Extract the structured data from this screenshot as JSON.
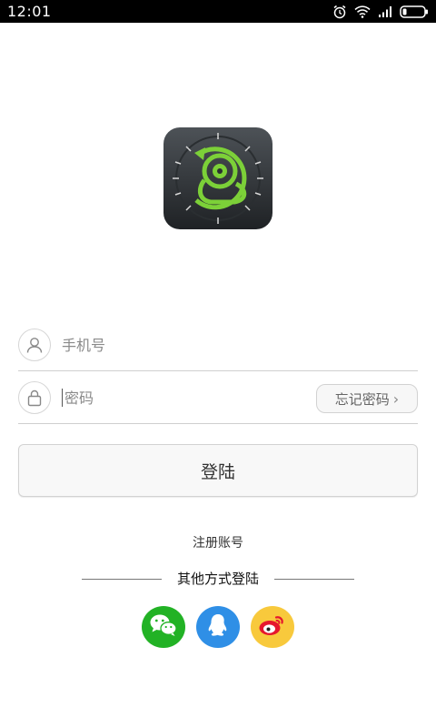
{
  "status_bar": {
    "time": "12:01",
    "icons": [
      "alarm-icon",
      "wifi-icon",
      "signal-icon",
      "battery-icon"
    ]
  },
  "app": {
    "logo_icon": "app-logo-icon",
    "accent_color": "#7cd038"
  },
  "login_form": {
    "phone_placeholder": "手机号",
    "password_placeholder": "密码",
    "forgot_password_label": "忘记密码",
    "login_button_label": "登陆"
  },
  "register_link_label": "注册账号",
  "other_login": {
    "label": "其他方式登陆",
    "options": [
      {
        "icon": "wechat-icon",
        "color": "#22b225"
      },
      {
        "icon": "qq-icon",
        "color": "#2f8fe6"
      },
      {
        "icon": "weibo-icon",
        "color": "#f8c93c"
      }
    ]
  }
}
